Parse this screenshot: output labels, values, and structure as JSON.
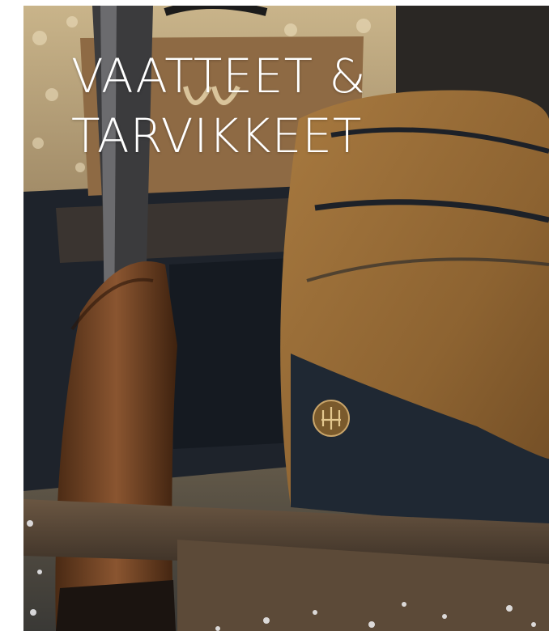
{
  "hero": {
    "title_line_1": "VAATTEET &",
    "title_line_2": "TARVIKKEET"
  },
  "colors": {
    "title_text": "#ffffff",
    "bag_canvas": "#9a6d35",
    "bag_panel": "#1f2833",
    "rifle_stock": "#6b3f1f",
    "page_background": "#ffffff"
  },
  "icons": {
    "brand_emblem": "beretta-trident-emblem-icon"
  }
}
